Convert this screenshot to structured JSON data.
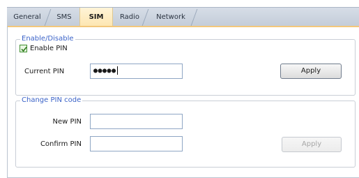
{
  "tabs": [
    {
      "label": "General",
      "active": false
    },
    {
      "label": "SMS",
      "active": false
    },
    {
      "label": "SIM",
      "active": true
    },
    {
      "label": "Radio",
      "active": false
    },
    {
      "label": "Network",
      "active": false
    }
  ],
  "enable_group": {
    "title": "Enable/Disable",
    "checkbox_label": "Enable PIN",
    "checkbox_checked": true,
    "current_pin_label": "Current PIN",
    "current_pin_value": "●●●●●",
    "apply_label": "Apply"
  },
  "change_group": {
    "title": "Change PIN code",
    "new_pin_label": "New PIN",
    "new_pin_value": "",
    "confirm_pin_label": "Confirm PIN",
    "confirm_pin_value": "",
    "apply_label": "Apply",
    "apply_enabled": false
  },
  "colors": {
    "group_title": "#3b63c8",
    "active_tab": "#fde6b0",
    "tab_strip": "#c3ccd8"
  }
}
